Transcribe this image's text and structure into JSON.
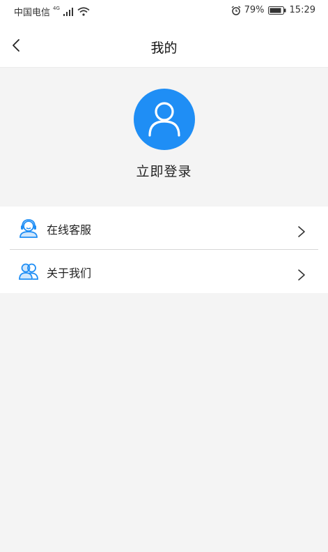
{
  "status_bar": {
    "carrier": "中国电信",
    "network": "4G",
    "battery": "79%",
    "time": "15:29",
    "icons": [
      "signal-icon",
      "wifi-icon",
      "alarm-icon",
      "battery-icon"
    ]
  },
  "header": {
    "title": "我的",
    "back_icon": "chevron-left-icon"
  },
  "profile": {
    "avatar_icon": "user-icon",
    "login_label": "立即登录",
    "accent_color": "#1f8ef5"
  },
  "menu": {
    "items": [
      {
        "label": "在线客服",
        "icon": "customer-service-icon"
      },
      {
        "label": "关于我们",
        "icon": "users-icon"
      }
    ]
  }
}
